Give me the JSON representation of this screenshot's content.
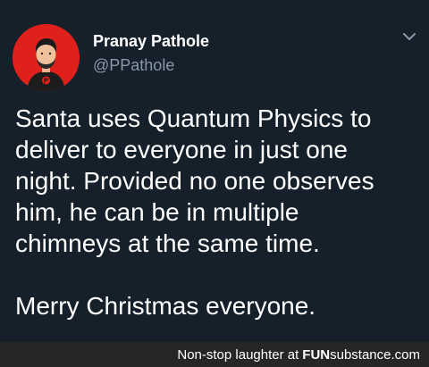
{
  "tweet": {
    "author": {
      "display_name": "Pranay Pathole",
      "handle": "@PPathole",
      "avatar_color": "#e0201b"
    },
    "menu_icon": "chevron-down-icon",
    "text_paragraphs": [
      "Santa uses Quantum Physics to\ndeliver to everyone in just one\nnight. Provided no one observes\nhim, he can be in multiple\nchimneys at the same time.",
      "Merry Christmas everyone."
    ]
  },
  "watermark": {
    "prefix": "Non-stop laughter at",
    "brand_bold": "FUN",
    "brand_rest": "substance.com"
  },
  "colors": {
    "background": "#15202b",
    "secondary_text": "#8899a6",
    "watermark_bar": "#262626"
  }
}
